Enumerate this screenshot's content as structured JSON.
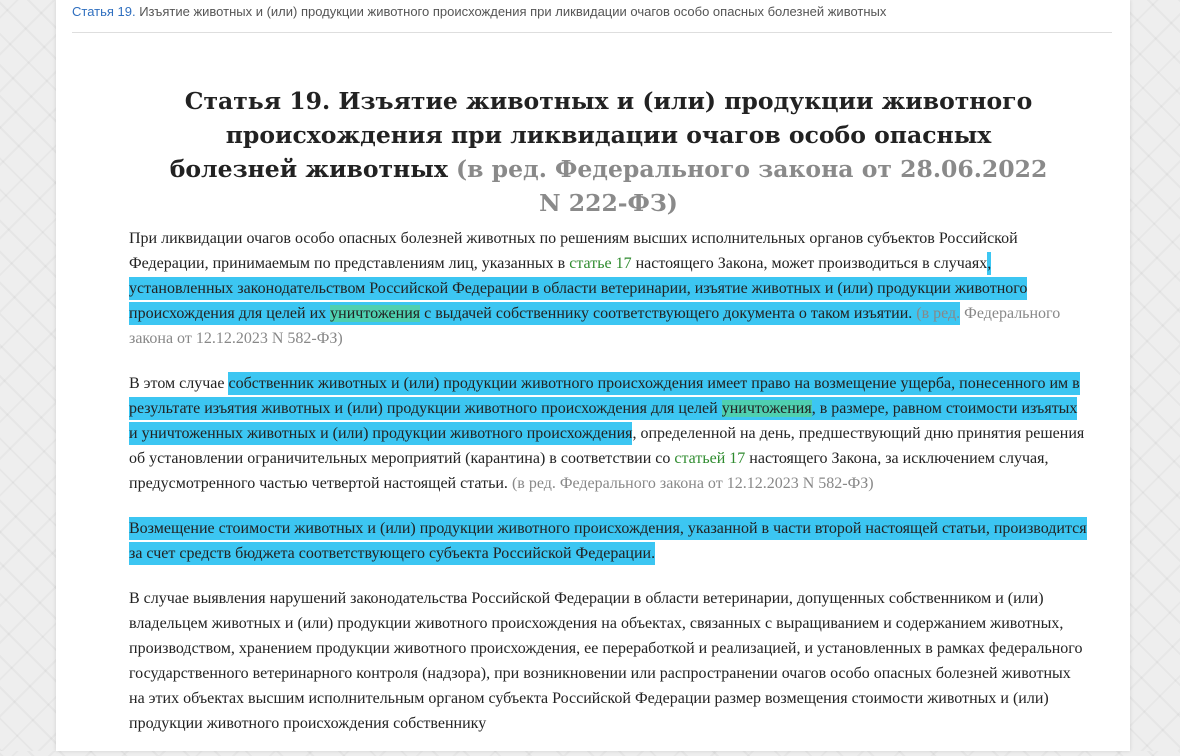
{
  "breadcrumb": {
    "link": "Статья 19.",
    "rest": " Изъятие животных и (или) продукции животного происхождения при ликвидации очагов особо опасных болезней животных"
  },
  "title": {
    "main": "Статья 19. Изъятие животных и (или) продукции животного происхождения при ликвидации очагов особо опасных болезней животных",
    "edition": "(в ред. Федерального закона от 28.06.2022 N 222-ФЗ)"
  },
  "p1": {
    "t1": "При ликвидации очагов особо опасных болезней животных по решениям высших исполнительных органов субъектов Российской Федерации, принимаемым по представлениям лиц, указанных в ",
    "ref": "статье 17",
    "t2": " настоящего Закона, может производиться в случаях",
    "h1": ", установленных законодательством Российской Федерации в области ветеринарии, изъятие животных и (или) продукции животного происхождения для целей их ",
    "h2": "уничтожения",
    "h3": " с выдачей собственнику соответствующего документа о таком изъятии. ",
    "h4": "(в ред.",
    "note": " Федерального закона от 12.12.2023 N 582-ФЗ)"
  },
  "p2": {
    "t1": "В этом случае ",
    "h1": "собственник животных и (или) продукции животного происхождения имеет право на возмещение ущерба, понесенного им в результате изъятия животных и (или) продукции животного происхождения для целей ",
    "h2": "уничтожения",
    "h3": ", в размере, равном стоимости изъятых и уничтоженных животных и (или) продукции животного происхождения",
    "t2": ", определенной на день, предшествующий дню принятия решения об установлении ограничительных мероприятий (карантина) в соответствии со ",
    "ref": "статьей 17",
    "t3": " настоящего Закона, за исключением случая, предусмотренного частью четвертой настоящей статьи. ",
    "note": "(в ред. Федерального закона от 12.12.2023 N 582-ФЗ)"
  },
  "p3": {
    "h1": "Возмещение стоимости животных и (или) продукции животного происхождения, указанной в части второй настоящей статьи, производится за счет средств бюджета соответствующего субъекта Российской Федерации."
  },
  "p4": {
    "t1": "В случае выявления нарушений законодательства Российской Федерации в области ветеринарии, допущенных собственником и (или) владельцем животных и (или) продукции животного происхождения на объектах, связанных с выращиванием и содержанием животных, производством, хранением продукции животного происхождения, ее переработкой и реализацией, и установленных в рамках федерального государственного ветеринарного контроля (надзора), при возникновении или распространении очагов особо опасных болезней животных на этих объектах высшим исполнительным органом субъекта Российской Федерации размер возмещения стоимости животных и (или) продукции животного происхождения собственнику"
  },
  "colors": {
    "highlight": "#3cc6f2",
    "highlight_overlap": "#4fd0b0",
    "reference_link": "#2e8b2e",
    "breadcrumb_link": "#2f6fbf",
    "note": "#888888"
  }
}
